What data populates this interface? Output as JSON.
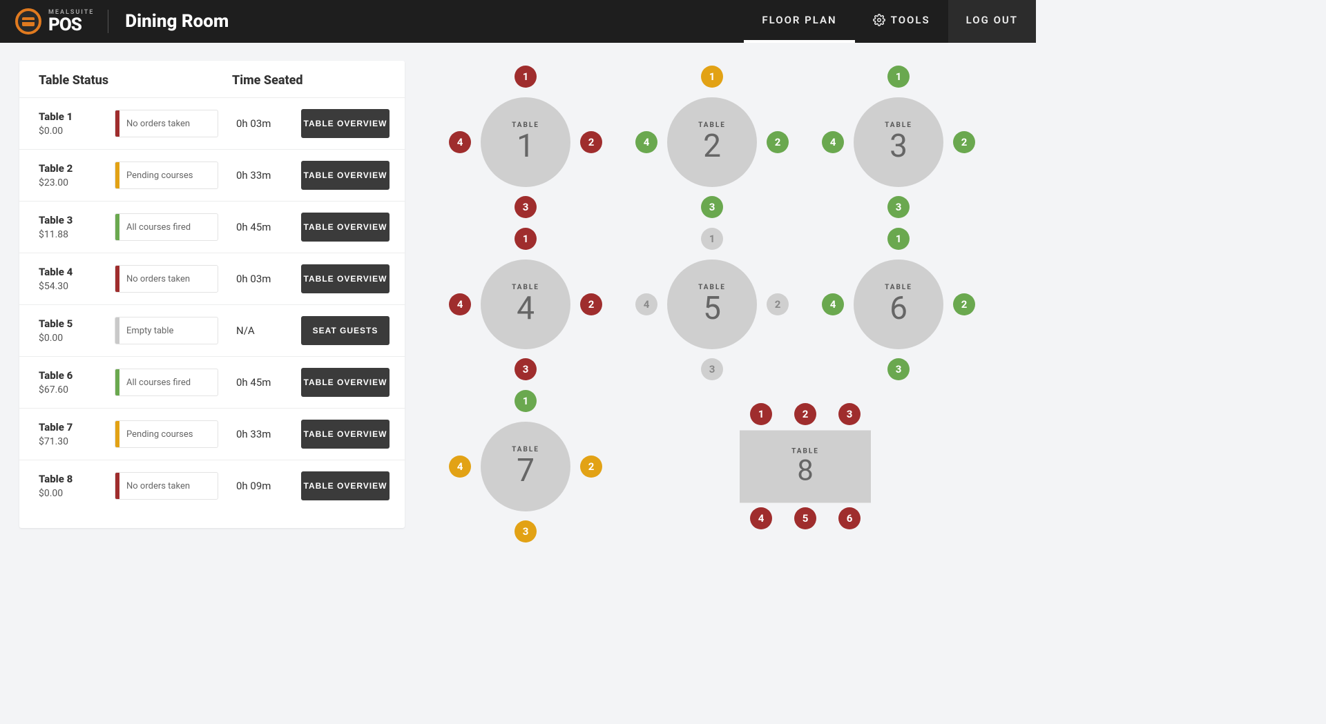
{
  "header": {
    "brand_top": "MEALSUITE",
    "brand_bottom": "POS",
    "title": "Dining Room",
    "nav": {
      "floor_plan": "FLOOR PLAN",
      "tools": "TOOLS",
      "logout": "LOG OUT"
    }
  },
  "panel": {
    "col_status": "Table Status",
    "col_time": "Time Seated",
    "rows": [
      {
        "name": "Table 1",
        "price": "$0.00",
        "status_label": "No orders taken",
        "status_color": "c-red",
        "time": "0h 03m",
        "action": "TABLE OVERVIEW"
      },
      {
        "name": "Table 2",
        "price": "$23.00",
        "status_label": "Pending courses",
        "status_color": "c-yellow",
        "time": "0h 33m",
        "action": "TABLE OVERVIEW"
      },
      {
        "name": "Table 3",
        "price": "$11.88",
        "status_label": "All courses fired",
        "status_color": "c-green",
        "time": "0h 45m",
        "action": "TABLE OVERVIEW"
      },
      {
        "name": "Table 4",
        "price": "$54.30",
        "status_label": "No orders taken",
        "status_color": "c-red",
        "time": "0h 03m",
        "action": "TABLE OVERVIEW"
      },
      {
        "name": "Table 5",
        "price": "$0.00",
        "status_label": "Empty table",
        "status_color": "c-grey",
        "time": "N/A",
        "action": "SEAT GUESTS"
      },
      {
        "name": "Table 6",
        "price": "$67.60",
        "status_label": "All courses fired",
        "status_color": "c-green",
        "time": "0h 45m",
        "action": "TABLE OVERVIEW"
      },
      {
        "name": "Table 7",
        "price": "$71.30",
        "status_label": "Pending courses",
        "status_color": "c-yellow",
        "time": "0h 33m",
        "action": "TABLE OVERVIEW"
      },
      {
        "name": "Table 8",
        "price": "$0.00",
        "status_label": "No orders taken",
        "status_color": "c-red",
        "time": "0h 09m",
        "action": "TABLE OVERVIEW"
      }
    ]
  },
  "floor": {
    "table_word": "TABLE",
    "round_tables": [
      {
        "num": "1",
        "seats": [
          {
            "n": "1",
            "c": "s-red"
          },
          {
            "n": "2",
            "c": "s-red"
          },
          {
            "n": "3",
            "c": "s-red"
          },
          {
            "n": "4",
            "c": "s-red"
          }
        ]
      },
      {
        "num": "2",
        "seats": [
          {
            "n": "1",
            "c": "s-yellow"
          },
          {
            "n": "2",
            "c": "s-green"
          },
          {
            "n": "3",
            "c": "s-green"
          },
          {
            "n": "4",
            "c": "s-green"
          }
        ]
      },
      {
        "num": "3",
        "seats": [
          {
            "n": "1",
            "c": "s-green"
          },
          {
            "n": "2",
            "c": "s-green"
          },
          {
            "n": "3",
            "c": "s-green"
          },
          {
            "n": "4",
            "c": "s-green"
          }
        ]
      },
      {
        "num": "4",
        "seats": [
          {
            "n": "1",
            "c": "s-red"
          },
          {
            "n": "2",
            "c": "s-red"
          },
          {
            "n": "3",
            "c": "s-red"
          },
          {
            "n": "4",
            "c": "s-red"
          }
        ]
      },
      {
        "num": "5",
        "seats": [
          {
            "n": "1",
            "c": "s-grey"
          },
          {
            "n": "2",
            "c": "s-grey"
          },
          {
            "n": "3",
            "c": "s-grey"
          },
          {
            "n": "4",
            "c": "s-grey"
          }
        ]
      },
      {
        "num": "6",
        "seats": [
          {
            "n": "1",
            "c": "s-green"
          },
          {
            "n": "2",
            "c": "s-green"
          },
          {
            "n": "3",
            "c": "s-green"
          },
          {
            "n": "4",
            "c": "s-green"
          }
        ]
      },
      {
        "num": "7",
        "seats": [
          {
            "n": "1",
            "c": "s-green"
          },
          {
            "n": "2",
            "c": "s-yellow"
          },
          {
            "n": "3",
            "c": "s-yellow"
          },
          {
            "n": "4",
            "c": "s-yellow"
          }
        ]
      }
    ],
    "rect_table": {
      "num": "8",
      "seats": [
        {
          "n": "1",
          "c": "s-red"
        },
        {
          "n": "2",
          "c": "s-red"
        },
        {
          "n": "3",
          "c": "s-red"
        },
        {
          "n": "4",
          "c": "s-red"
        },
        {
          "n": "5",
          "c": "s-red"
        },
        {
          "n": "6",
          "c": "s-red"
        }
      ]
    }
  }
}
